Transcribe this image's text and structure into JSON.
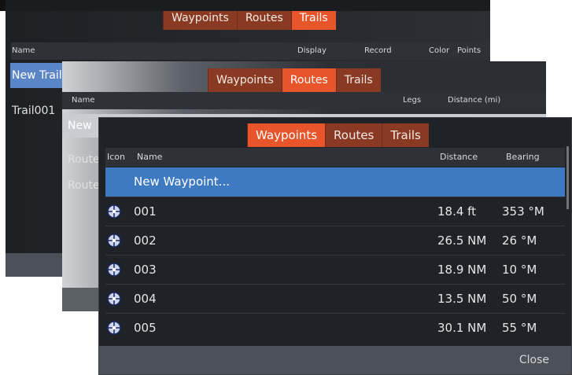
{
  "trails_panel": {
    "tabs": [
      "Waypoints",
      "Routes",
      "Trails"
    ],
    "active_tab": "Trails",
    "columns": [
      "Name",
      "Display",
      "Record",
      "Color",
      "Points"
    ],
    "rows": [
      "New Trail...",
      "Trail001"
    ]
  },
  "routes_panel": {
    "tabs": [
      "Waypoints",
      "Routes",
      "Trails"
    ],
    "active_tab": "Routes",
    "columns": [
      "Name",
      "Legs",
      "Distance (mi)"
    ],
    "rows": [
      "New",
      "Route",
      "Route"
    ]
  },
  "waypoints_panel": {
    "tabs": [
      "Waypoints",
      "Routes",
      "Trails"
    ],
    "active_tab": "Waypoints",
    "columns": [
      "Icon",
      "Name",
      "Distance",
      "Bearing"
    ],
    "new_item": "New Waypoint...",
    "rows": [
      {
        "name": "001",
        "distance": "18.4 ft",
        "bearing": "353 °M"
      },
      {
        "name": "002",
        "distance": "26.5 NM",
        "bearing": "26 °M"
      },
      {
        "name": "003",
        "distance": "18.9 NM",
        "bearing": "10 °M"
      },
      {
        "name": "004",
        "distance": "13.5 NM",
        "bearing": "50 °M"
      },
      {
        "name": "005",
        "distance": "30.1 NM",
        "bearing": "55 °M"
      }
    ],
    "row_icon": "waypoint-crosshair-icon",
    "close_label": "Close"
  },
  "colors": {
    "tab_active": "#e8552a",
    "tab_inactive": "#8a3a22",
    "selection": "#3e7ac2"
  }
}
